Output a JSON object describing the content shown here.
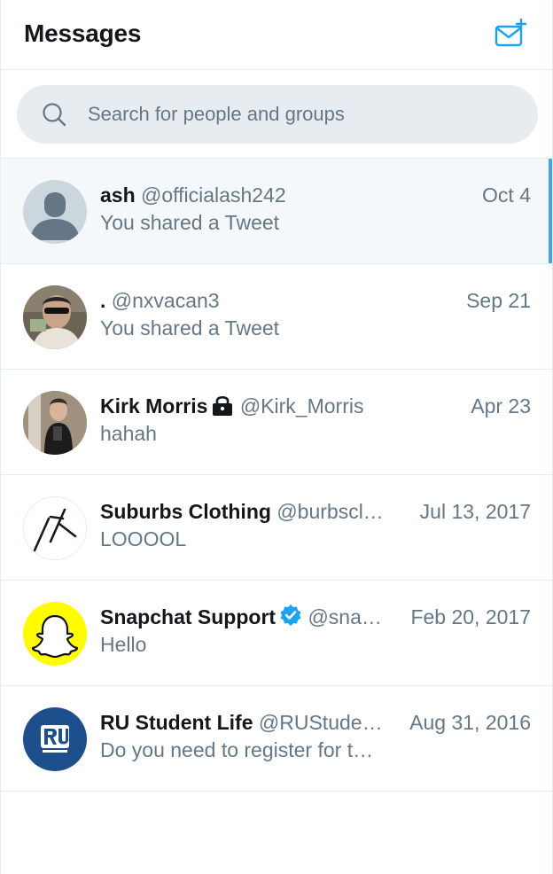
{
  "header": {
    "title": "Messages",
    "new_message_icon": "envelope-plus-icon"
  },
  "search": {
    "placeholder": "Search for people and groups",
    "icon": "search-icon"
  },
  "colors": {
    "accent": "#1da1f2",
    "selected_bar": "#4aa3e8",
    "muted_text": "#657786",
    "search_bg": "#e6ecf0"
  },
  "conversations": [
    {
      "name": "ash",
      "handle": "@officialash242",
      "date": "Oct 4",
      "preview": "You shared a Tweet",
      "selected": true,
      "avatar": "default-avatar"
    },
    {
      "name": ".",
      "handle": "@nxvacan3",
      "date": "Sep 21",
      "preview": "You shared a Tweet",
      "selected": false,
      "avatar": "photo-avatar"
    },
    {
      "name": "Kirk Morris",
      "handle": "@Kirk_Morris",
      "date": "Apr 23",
      "preview": "hahah",
      "selected": false,
      "avatar": "photo-avatar",
      "badge": "lock-icon"
    },
    {
      "name": "Suburbs Clothing",
      "handle": "@burbscl…",
      "date": "Jul 13, 2017",
      "preview": "LOOOOL",
      "selected": false,
      "avatar": "logo-avatar"
    },
    {
      "name": "Snapchat Support",
      "handle": "@sna…",
      "date": "Feb 20, 2017",
      "preview": "Hello",
      "selected": false,
      "avatar": "snapchat-ghost-avatar",
      "badge": "verified-icon"
    },
    {
      "name": "RU Student Life",
      "handle": "@RUStude…",
      "date": "Aug 31, 2016",
      "preview": "Do you need to register for t…",
      "selected": false,
      "avatar": "ru-logo-avatar"
    }
  ]
}
